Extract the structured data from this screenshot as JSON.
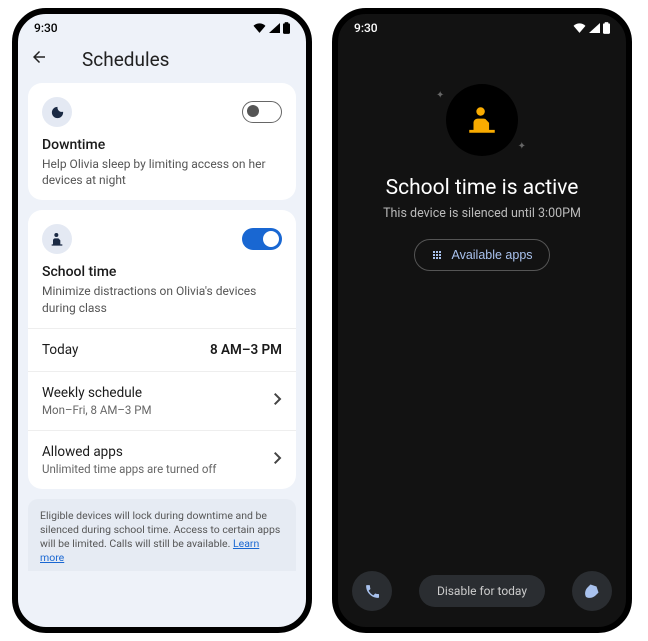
{
  "status_time": "9:30",
  "left": {
    "header_title": "Schedules",
    "downtime": {
      "title": "Downtime",
      "subtitle": "Help Olivia sleep by limiting access on her devices at night",
      "toggle_on": false
    },
    "schooltime": {
      "title": "School time",
      "subtitle": "Minimize distractions on Olivia's devices during class",
      "toggle_on": true,
      "today_label": "Today",
      "today_value": "8 AM–3 PM",
      "weekly_label": "Weekly schedule",
      "weekly_value": "Mon–Fri, 8 AM–3 PM",
      "allowed_label": "Allowed apps",
      "allowed_value": "Unlimited time apps are turned off"
    },
    "footer_text": "Eligible devices will lock during downtime and be silenced during school time. Access to certain apps will be limited. Calls will still be available. ",
    "footer_link": "Learn more"
  },
  "right": {
    "hero_title": "School time is active",
    "hero_sub": "This device is silenced until 3:00PM",
    "available_btn": "Available apps",
    "disable_label": "Disable for today"
  }
}
